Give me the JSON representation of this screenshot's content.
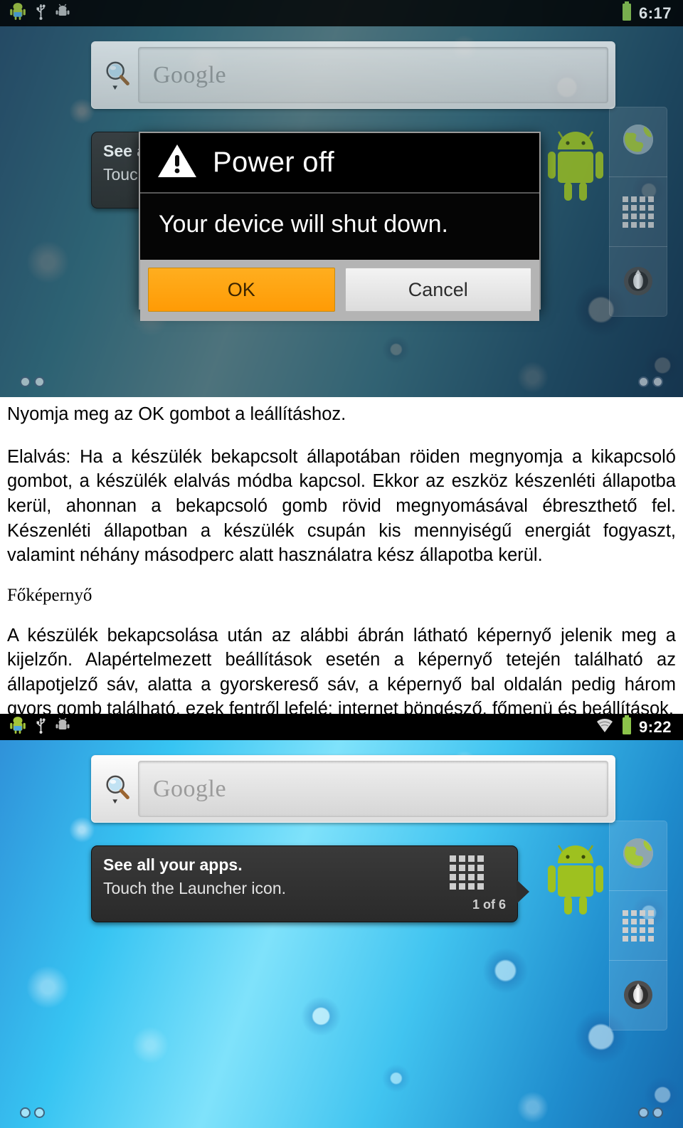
{
  "document": {
    "intro_line": "Nyomja meg az OK gombot a leállításhoz.",
    "paragraph_sleep": "Elalvás: Ha a készülék bekapcsolt állapotában röiden megnyomja a kikapcsoló gombot, a készülék elalvás módba kapcsol. Ekkor az eszköz készenléti állapotba kerül, ahonnan a bekapcsoló gomb rövid megnyomásával ébreszthető fel. Készenléti állapotban a készülék csupán kis mennyiségű energiát fogyaszt, valamint néhány másodperc alatt használatra kész állapotba kerül.",
    "heading_home": "Főképernyő",
    "paragraph_home": "A készülék bekapcsolása után az alábbi ábrán látható képernyő jelenik meg a kijelzőn. Alapértelmezett beállítások esetén a képernyő tetején található az állapotjelző sáv, alatta a gyorskereső sáv, a képernyő bal oldalán pedig három gyors gomb található, ezek fentről lefelé: internet böngésző, főmenü és beállítások."
  },
  "screenshot_top": {
    "statusbar": {
      "time": "6:17",
      "icons_left": [
        "android-robot-icon",
        "usb-icon",
        "adb-debug-icon"
      ],
      "icons_right": [
        "battery-icon"
      ]
    },
    "search_widget": {
      "placeholder": "Google",
      "icons": [
        "search-icon",
        "voice-dropdown-icon"
      ]
    },
    "tooltip": {
      "title": "See all your apps.",
      "subtitle": "Touch the Launcher icon.",
      "counter": "",
      "icon": "launcher-grid-icon"
    },
    "dock": {
      "buttons": [
        "browser-globe-icon",
        "launcher-grid-icon",
        "settings-dial-icon"
      ]
    },
    "dialog": {
      "title": "Power off",
      "message": "Your device will shut down.",
      "icon": "warning-triangle-icon",
      "ok_label": "OK",
      "cancel_label": "Cancel",
      "ok_color": "#ff9f0a",
      "cancel_color": "#e8e8e8"
    }
  },
  "screenshot_bottom": {
    "statusbar": {
      "time": "9:22",
      "icons_left": [
        "android-robot-icon",
        "usb-icon",
        "adb-debug-icon"
      ],
      "icons_right": [
        "wifi-icon",
        "battery-icon"
      ]
    },
    "search_widget": {
      "placeholder": "Google",
      "icons": [
        "search-icon",
        "voice-dropdown-icon"
      ]
    },
    "tooltip": {
      "title": "See all your apps.",
      "subtitle": "Touch the Launcher icon.",
      "counter": "1 of 6",
      "icon": "launcher-grid-icon"
    },
    "dock": {
      "buttons": [
        "browser-globe-icon",
        "launcher-grid-icon",
        "settings-dial-icon"
      ]
    }
  }
}
